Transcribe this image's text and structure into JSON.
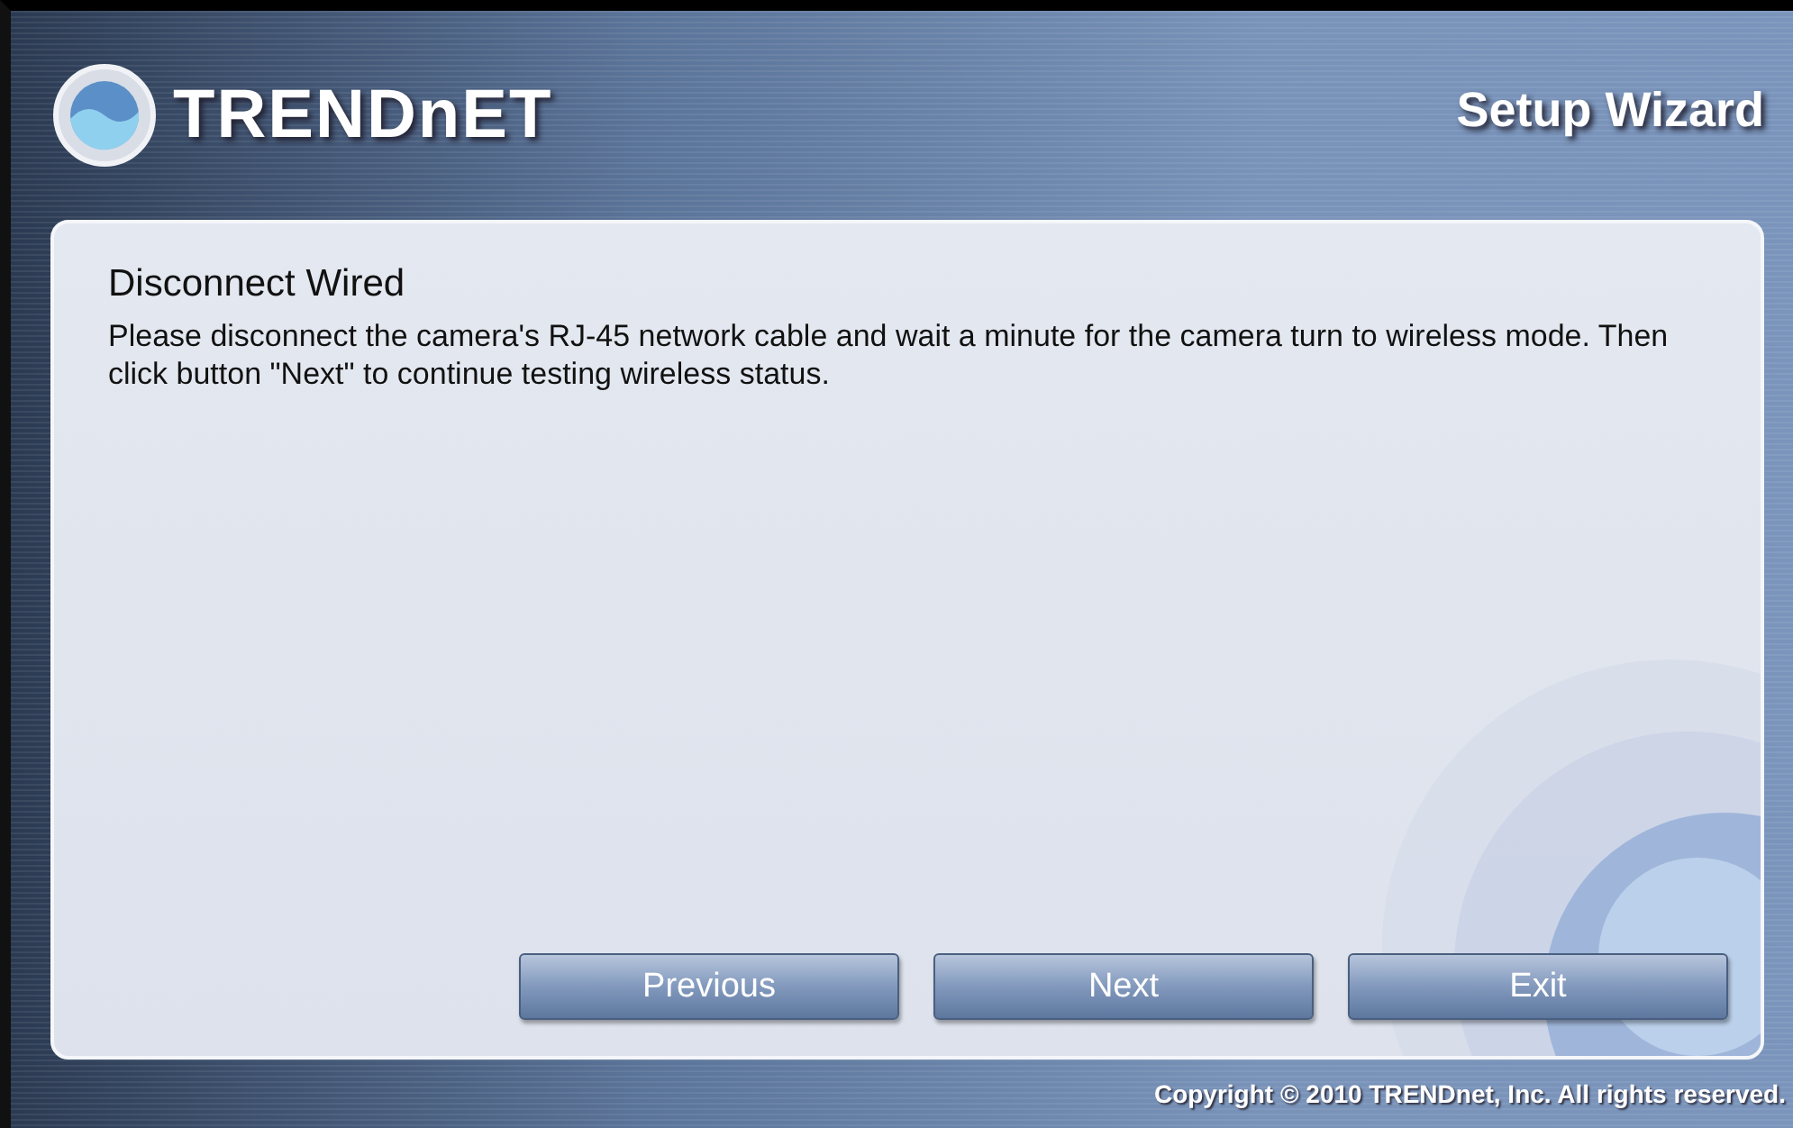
{
  "header": {
    "logo_text": "TRENDnET",
    "title": "Setup Wizard"
  },
  "panel": {
    "heading": "Disconnect Wired",
    "message": "Please disconnect the camera's RJ-45 network cable and wait a minute for the camera turn to wireless mode. Then click button \"Next\" to continue testing wireless status."
  },
  "buttons": [
    "Previous",
    "Next",
    "Exit"
  ],
  "footer": {
    "copyright": "Copyright © 2010 TRENDnet, Inc. All rights reserved."
  }
}
